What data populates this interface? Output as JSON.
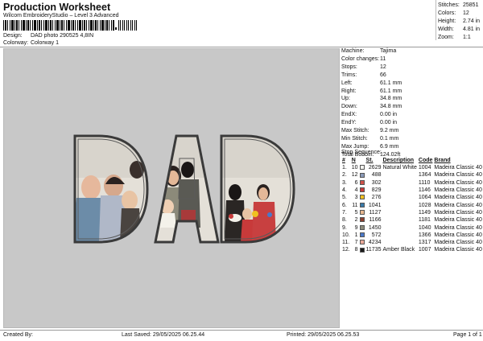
{
  "header": {
    "title": "Production Worksheet",
    "subtitle": "Wilcom EmbroideryStudio – Level 3 Advanced",
    "design_label": "Design:",
    "design_value": "DAD photo 290525 4,8IN",
    "colorway_label": "Colorway:",
    "colorway_value": "Colorway 1"
  },
  "stats": [
    {
      "label": "Stitches:",
      "value": "25851"
    },
    {
      "label": "Colors:",
      "value": "12"
    },
    {
      "label": "Height:",
      "value": "2.74 in"
    },
    {
      "label": "Width:",
      "value": "4.81 in"
    },
    {
      "label": "Zoom:",
      "value": "1:1"
    }
  ],
  "machine_info": [
    {
      "label": "Machine:",
      "value": "Tajima"
    },
    {
      "label": "Color changes:",
      "value": "11"
    },
    {
      "label": "Stops:",
      "value": "12"
    },
    {
      "label": "Trims:",
      "value": "66"
    },
    {
      "label": "Left:",
      "value": "61.1 mm"
    },
    {
      "label": "Right:",
      "value": "61.1 mm"
    },
    {
      "label": "Up:",
      "value": "34.8 mm"
    },
    {
      "label": "Down:",
      "value": "34.8 mm"
    },
    {
      "label": "EndX:",
      "value": "0.00 in"
    },
    {
      "label": "EndY:",
      "value": "0.00 in"
    },
    {
      "label": "Max Stitch:",
      "value": "9.2 mm"
    },
    {
      "label": "Min Stitch:",
      "value": "0.1 mm"
    },
    {
      "label": "Max Jump:",
      "value": "6.9 mm"
    },
    {
      "label": "Total Bobbin:",
      "value": "124.02ft"
    }
  ],
  "stop_sequence": {
    "title": "Stop Sequence:",
    "headers": [
      "#",
      "N",
      "",
      "St.",
      "Description",
      "Code",
      "Brand"
    ],
    "rows": [
      {
        "idx": "1.",
        "n": "10",
        "color": "#f4f4f0",
        "st": "2629",
        "desc": "Natural White",
        "code": "1004",
        "brand": "Madeira Classic 40"
      },
      {
        "idx": "2.",
        "n": "12",
        "color": "#8a9ab8",
        "st": "488",
        "desc": "",
        "code": "1364",
        "brand": "Madeira Classic 40"
      },
      {
        "idx": "3.",
        "n": "6",
        "color": "#d0524a",
        "st": "302",
        "desc": "",
        "code": "1110",
        "brand": "Madeira Classic 40"
      },
      {
        "idx": "4.",
        "n": "4",
        "color": "#c83a3a",
        "st": "829",
        "desc": "",
        "code": "1146",
        "brand": "Madeira Classic 40"
      },
      {
        "idx": "5.",
        "n": "3",
        "color": "#f0c020",
        "st": "276",
        "desc": "",
        "code": "1064",
        "brand": "Madeira Classic 40"
      },
      {
        "idx": "6.",
        "n": "11",
        "color": "#3a7aa8",
        "st": "1041",
        "desc": "",
        "code": "1028",
        "brand": "Madeira Classic 40"
      },
      {
        "idx": "7.",
        "n": "5",
        "color": "#e8b890",
        "st": "1127",
        "desc": "",
        "code": "1149",
        "brand": "Madeira Classic 40"
      },
      {
        "idx": "8.",
        "n": "2",
        "color": "#8c4030",
        "st": "1166",
        "desc": "",
        "code": "1181",
        "brand": "Madeira Classic 40"
      },
      {
        "idx": "9.",
        "n": "9",
        "color": "#8c8a7a",
        "st": "1450",
        "desc": "",
        "code": "1040",
        "brand": "Madeira Classic 40"
      },
      {
        "idx": "10.",
        "n": "1",
        "color": "#4a78c8",
        "st": "572",
        "desc": "",
        "code": "1366",
        "brand": "Madeira Classic 40"
      },
      {
        "idx": "11.",
        "n": "7",
        "color": "#e8a898",
        "st": "4234",
        "desc": "",
        "code": "1317",
        "brand": "Madeira Classic 40"
      },
      {
        "idx": "12.",
        "n": "8",
        "color": "#1a1a1a",
        "st": "11735",
        "desc": "Amber Black",
        "code": "1007",
        "brand": "Madeira Classic 40"
      }
    ]
  },
  "footer": {
    "created_by": "Created By:",
    "last_saved": "Last Saved: 29/05/2025 06.25.44",
    "printed": "Printed: 29/05/2025 06.25.53",
    "page": "Page 1 of 1"
  }
}
